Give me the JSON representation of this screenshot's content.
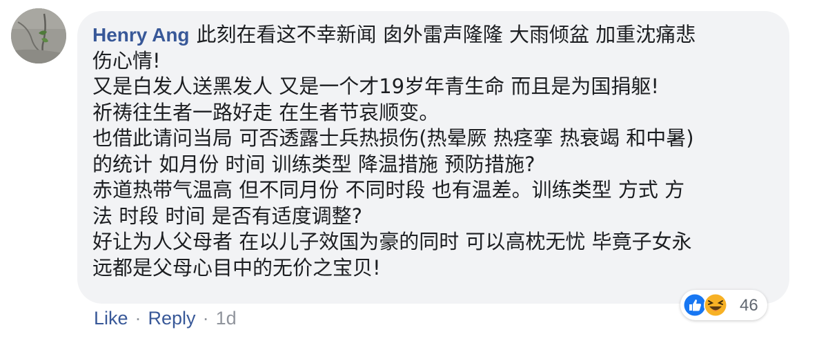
{
  "comment": {
    "author": "Henry Ang",
    "lines": [
      "此刻在看这不幸新闻 囱外雷声隆隆 大雨倾盆 加重沈痛悲",
      "伤心情!",
      "又是白发人送黑发人 又是一个才19岁年青生命 而且是为国捐躯!",
      "祈祷往生者一路好走 在生者节哀顺变。",
      "也借此请问当局 可否透露士兵热损伤(热晕厥 热痉挛 热衰竭 和中暑)",
      "的统计 如月份 时间 训练类型 降温措施 预防措施?",
      "赤道热带气温高 但不同月份 不同时段 也有温差。训练类型 方式 方",
      "法 时段 时间 是否有适度调整?",
      "好让为人父母者 在以儿子效国为豪的同时 可以高枕无忧 毕竟子女永",
      "远都是父母心目中的无价之宝贝!"
    ],
    "reactions": {
      "icons": [
        "like-icon",
        "haha-icon"
      ],
      "count": "46"
    },
    "actions": {
      "like": "Like",
      "separator": "·",
      "reply": "Reply",
      "time": "1d"
    }
  },
  "colors": {
    "author": "#385898",
    "bubble": "#f2f3f5",
    "like_blue": "#1877f2",
    "haha_yellow": "#f7b125"
  }
}
